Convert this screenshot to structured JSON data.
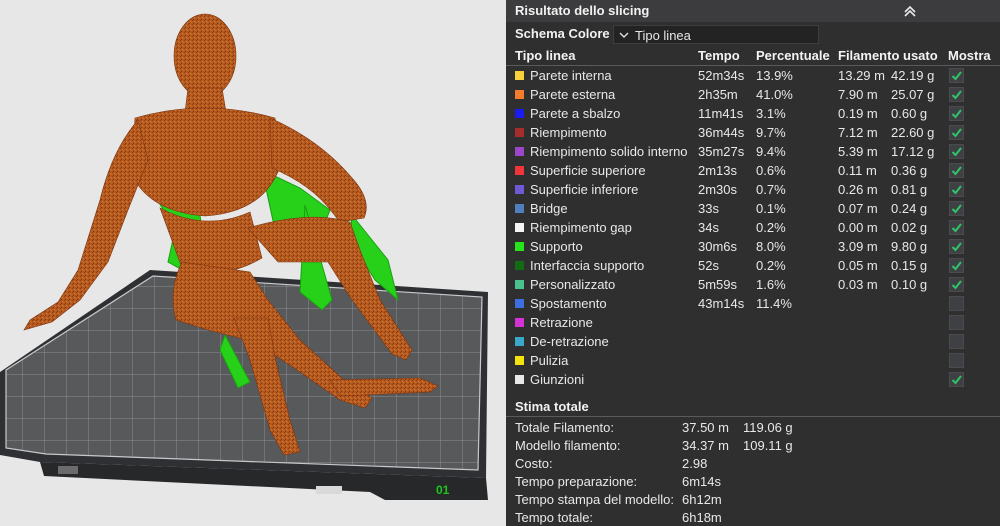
{
  "viewport": {
    "plate_label": "01",
    "plate_model_color": "#b4561d",
    "support_color": "#2bd10f"
  },
  "panel": {
    "title": "Risultato dello slicing",
    "collapse_icon": "chevron-double-up-icon",
    "color_scheme_label": "Schema Colore",
    "color_scheme_value": "Tipo linea",
    "headers": {
      "type": "Tipo linea",
      "time": "Tempo",
      "percent": "Percentuale",
      "filament": "Filamento usato",
      "show": "Mostra"
    },
    "rows": [
      {
        "label": "Parete interna",
        "color": "#f7d23c",
        "time": "52m34s",
        "percent": "13.9%",
        "length": "13.29 m",
        "weight": "42.19 g",
        "shown": true,
        "enabled": true
      },
      {
        "label": "Parete esterna",
        "color": "#f47c2c",
        "time": "2h35m",
        "percent": "41.0%",
        "length": "7.90 m",
        "weight": "25.07 g",
        "shown": true,
        "enabled": true
      },
      {
        "label": "Parete a sbalzo",
        "color": "#1c1cf0",
        "time": "11m41s",
        "percent": "3.1%",
        "length": "0.19 m",
        "weight": "0.60 g",
        "shown": true,
        "enabled": true
      },
      {
        "label": "Riempimento",
        "color": "#a72c2c",
        "time": "36m44s",
        "percent": "9.7%",
        "length": "7.12 m",
        "weight": "22.60 g",
        "shown": true,
        "enabled": true
      },
      {
        "label": "Riempimento solido interno",
        "color": "#9c46c9",
        "time": "35m27s",
        "percent": "9.4%",
        "length": "5.39 m",
        "weight": "17.12 g",
        "shown": true,
        "enabled": true
      },
      {
        "label": "Superficie superiore",
        "color": "#f0363a",
        "time": "2m13s",
        "percent": "0.6%",
        "length": "0.11 m",
        "weight": "0.36 g",
        "shown": true,
        "enabled": true
      },
      {
        "label": "Superficie inferiore",
        "color": "#7159d6",
        "time": "2m30s",
        "percent": "0.7%",
        "length": "0.26 m",
        "weight": "0.81 g",
        "shown": true,
        "enabled": true
      },
      {
        "label": "Bridge",
        "color": "#4f7fbf",
        "time": "33s",
        "percent": "0.1%",
        "length": "0.07 m",
        "weight": "0.24 g",
        "shown": true,
        "enabled": true
      },
      {
        "label": "Riempimento gap",
        "color": "#f4f4f4",
        "time": "34s",
        "percent": "0.2%",
        "length": "0.00 m",
        "weight": "0.02 g",
        "shown": true,
        "enabled": true
      },
      {
        "label": "Supporto",
        "color": "#27e31b",
        "time": "30m6s",
        "percent": "8.0%",
        "length": "3.09 m",
        "weight": "9.80 g",
        "shown": true,
        "enabled": true
      },
      {
        "label": "Interfaccia supporto",
        "color": "#136b13",
        "time": "52s",
        "percent": "0.2%",
        "length": "0.05 m",
        "weight": "0.15 g",
        "shown": true,
        "enabled": true
      },
      {
        "label": "Personalizzato",
        "color": "#4bc28e",
        "time": "5m59s",
        "percent": "1.6%",
        "length": "0.03 m",
        "weight": "0.10 g",
        "shown": true,
        "enabled": true
      },
      {
        "label": "Spostamento",
        "color": "#3d6fe0",
        "time": "43m14s",
        "percent": "11.4%",
        "length": "",
        "weight": "",
        "shown": false,
        "enabled": false
      },
      {
        "label": "Retrazione",
        "color": "#d532d5",
        "time": "",
        "percent": "",
        "length": "",
        "weight": "",
        "shown": false,
        "enabled": false
      },
      {
        "label": "De-retrazione",
        "color": "#3aa9c9",
        "time": "",
        "percent": "",
        "length": "",
        "weight": "",
        "shown": false,
        "enabled": false
      },
      {
        "label": "Pulizia",
        "color": "#f3e30e",
        "time": "",
        "percent": "",
        "length": "",
        "weight": "",
        "shown": false,
        "enabled": false
      },
      {
        "label": "Giunzioni",
        "color": "#e8e8e8",
        "time": "",
        "percent": "",
        "length": "",
        "weight": "",
        "shown": true,
        "enabled": true
      }
    ],
    "summary": {
      "title": "Stima totale",
      "rows": [
        {
          "key": "Totale Filamento:",
          "v1": "37.50 m",
          "v2": "119.06 g"
        },
        {
          "key": "Modello filamento:",
          "v1": "34.37 m",
          "v2": "109.11 g"
        },
        {
          "key": "Costo:",
          "v1": "2.98",
          "v2": ""
        },
        {
          "key": "Tempo preparazione:",
          "v1": "6m14s",
          "v2": ""
        },
        {
          "key": "Tempo stampa del modello:",
          "v1": "6h12m",
          "v2": ""
        },
        {
          "key": "Tempo totale:",
          "v1": "6h18m",
          "v2": ""
        }
      ]
    }
  }
}
